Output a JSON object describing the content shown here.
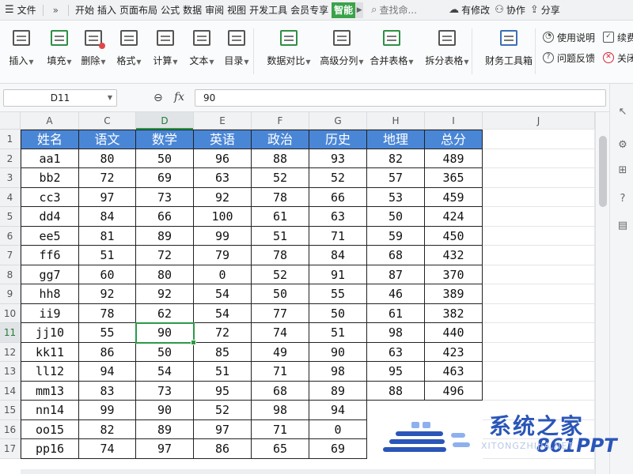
{
  "menubar": {
    "file_label": "文件",
    "more_arrows": "»",
    "tabs": [
      "开始",
      "插入",
      "页面布局",
      "公式",
      "数据",
      "审阅",
      "视图",
      "开发工具",
      "会员专享"
    ],
    "smart_tab": "智能",
    "search_placeholder": "查找命...",
    "right_items": [
      {
        "icon": "cloud-icon",
        "label": "有修改"
      },
      {
        "icon": "user-collab-icon",
        "label": "协作"
      },
      {
        "icon": "share-icon",
        "label": "分享"
      }
    ]
  },
  "ribbon": {
    "buttons": [
      {
        "label": "插入",
        "icon": "insert-icon"
      },
      {
        "label": "填充",
        "icon": "fill-icon"
      },
      {
        "label": "删除",
        "icon": "delete-icon"
      },
      {
        "label": "格式",
        "icon": "format-icon"
      },
      {
        "label": "计算",
        "icon": "calculate-icon"
      },
      {
        "label": "文本",
        "icon": "text-icon"
      },
      {
        "label": "目录",
        "icon": "catalog-icon"
      },
      {
        "label": "数据对比",
        "icon": "data-compare-icon"
      },
      {
        "label": "高级分列",
        "icon": "advanced-split-icon"
      },
      {
        "label": "合并表格",
        "icon": "merge-table-icon"
      },
      {
        "label": "拆分表格",
        "icon": "split-table-icon"
      },
      {
        "label": "财务工具箱",
        "icon": "finance-toolbox-icon"
      }
    ],
    "side_items": [
      {
        "label": "使用说明",
        "icon": "manual-icon"
      },
      {
        "label": "续费",
        "icon": "renew-icon"
      },
      {
        "label": "问题反馈",
        "icon": "feedback-icon"
      },
      {
        "label": "关闭",
        "icon": "close-icon"
      }
    ]
  },
  "formula_bar": {
    "name_box": "D11",
    "fx_label": "fx",
    "value": "90"
  },
  "sheet": {
    "columns": [
      "A",
      "C",
      "D",
      "E",
      "F",
      "G",
      "H",
      "I",
      "J"
    ],
    "active_column": "D",
    "active_row": "11",
    "row_numbers": [
      "1",
      "2",
      "3",
      "4",
      "5",
      "6",
      "7",
      "8",
      "9",
      "10",
      "11",
      "12",
      "13",
      "14",
      "15",
      "16",
      "17"
    ],
    "headers": [
      "姓名",
      "语文",
      "数学",
      "英语",
      "政治",
      "历史",
      "地理",
      "总分"
    ],
    "header_color": "#4a86d6",
    "selection_color": "#2c9a47",
    "rows": [
      [
        "aa1",
        "80",
        "50",
        "96",
        "88",
        "93",
        "82",
        "489"
      ],
      [
        "bb2",
        "72",
        "69",
        "63",
        "52",
        "52",
        "57",
        "365"
      ],
      [
        "cc3",
        "97",
        "73",
        "92",
        "78",
        "66",
        "53",
        "459"
      ],
      [
        "dd4",
        "84",
        "66",
        "100",
        "61",
        "63",
        "50",
        "424"
      ],
      [
        "ee5",
        "81",
        "89",
        "99",
        "51",
        "71",
        "59",
        "450"
      ],
      [
        "ff6",
        "51",
        "72",
        "79",
        "78",
        "84",
        "68",
        "432"
      ],
      [
        "gg7",
        "60",
        "80",
        "0",
        "52",
        "91",
        "87",
        "370"
      ],
      [
        "hh8",
        "92",
        "92",
        "54",
        "50",
        "55",
        "46",
        "389"
      ],
      [
        "ii9",
        "78",
        "62",
        "54",
        "77",
        "50",
        "61",
        "382"
      ],
      [
        "jj10",
        "55",
        "90",
        "72",
        "74",
        "51",
        "98",
        "440"
      ],
      [
        "kk11",
        "86",
        "50",
        "85",
        "49",
        "90",
        "63",
        "423"
      ],
      [
        "ll12",
        "94",
        "54",
        "51",
        "71",
        "98",
        "95",
        "463"
      ],
      [
        "mm13",
        "83",
        "73",
        "95",
        "68",
        "89",
        "88",
        "496"
      ],
      [
        "nn14",
        "99",
        "90",
        "52",
        "98",
        "94",
        "",
        ""
      ],
      [
        "oo15",
        "82",
        "89",
        "97",
        "71",
        "0",
        "",
        ""
      ],
      [
        "pp16",
        "74",
        "97",
        "86",
        "65",
        "69",
        "",
        ""
      ]
    ]
  },
  "watermark": {
    "text": "系统之家",
    "brand": "861PPT",
    "sub": "XITONGZHIJIA.NET"
  }
}
